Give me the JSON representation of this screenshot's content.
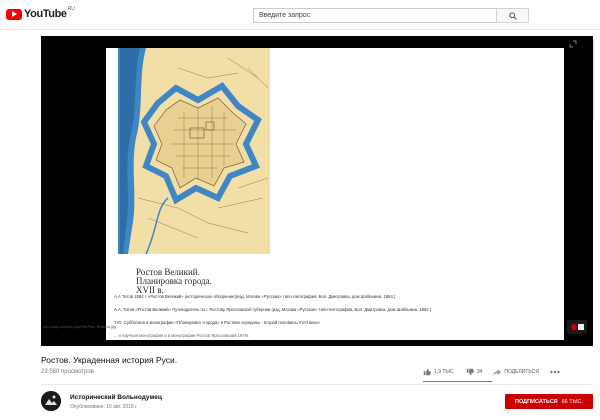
{
  "header": {
    "logo_text": "YouTube",
    "logo_region": "RU",
    "search_placeholder": "Введите запрос"
  },
  "video": {
    "map_caption": [
      "Ростов Великий.",
      "Планировка города.",
      "XVII в."
    ],
    "references": [
      "А.А Титов 1884 г. «Ростов Великий» (историческое обозрение)(изд. Москва «Русская» типо-литография, Бол. Дмитровка, дом Шабльмна. 1884.)",
      "А.А. Титов «Ростов Великий» Путеводитель по г. Ростову Ярославской губернии (изд. Москва «Русская» типо-литография, Бол. Дмитровка, дом Шабльмна. 1884.)",
      "Т.Ю. Субботина в монографии «Планировка «города» в Ростове середины - второй половины XVIII века»",
      "... и научная монография и в монографии Ростов Ярославский 1976г."
    ],
    "source_url": "wiki.rusgo.ru/index.php/File:Plan_Rostova.jpg",
    "title": "Ростов. Украденная история Руси.",
    "views": "23 560 просмотров"
  },
  "actions": {
    "likes": "1,9 ТЫС.",
    "dislikes": "34",
    "share_label": "ПОДЕЛИТЬСЯ",
    "like_ratio": 0.98
  },
  "channel": {
    "name": "Исторический Вольнодумец",
    "published": "Опубликовано: 10 авг. 2018 г.",
    "subscribe_label": "ПОДПИСАТЬСЯ",
    "subscriber_count": "66 ТЫС."
  },
  "colors": {
    "brand_red": "#ff0000",
    "subscribe_red": "#cc0000",
    "river_blue": "#3f86c4",
    "map_paper": "#f2dfa8"
  },
  "icons": [
    "youtube-logo-icon",
    "search-icon",
    "expand-icon",
    "like-icon",
    "dislike-icon",
    "share-icon",
    "more-icon"
  ]
}
